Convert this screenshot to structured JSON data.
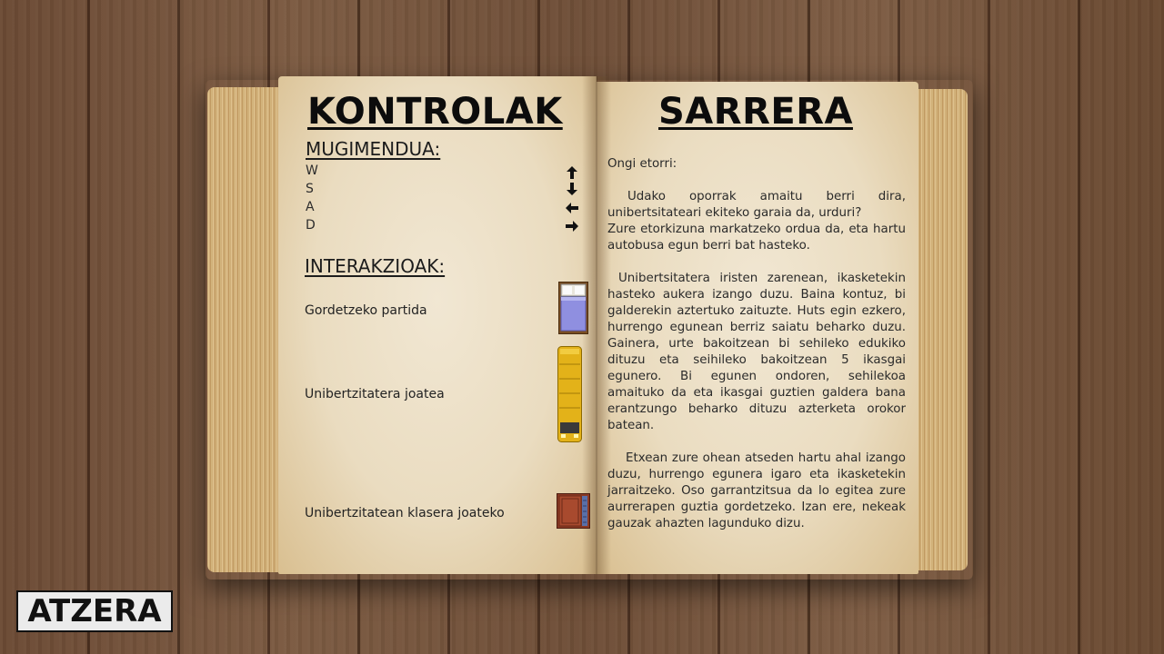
{
  "left_page": {
    "title": "KONTROLAK",
    "movement_heading": "MUGIMENDUA:",
    "keys": [
      {
        "key": "W",
        "icon": "arrow-up-icon"
      },
      {
        "key": "S",
        "icon": "arrow-down-icon"
      },
      {
        "key": "A",
        "icon": "arrow-left-icon"
      },
      {
        "key": "D",
        "icon": "arrow-right-icon"
      }
    ],
    "interactions_heading": "INTERAKZIOAK:",
    "actions": [
      {
        "label": "Gordetzeko partida",
        "icon": "bed-icon"
      },
      {
        "label": "Unibertzitatera joatea",
        "icon": "bus-icon"
      },
      {
        "label": "Unibertzitatean klasera joateko",
        "icon": "door-icon"
      }
    ]
  },
  "right_page": {
    "title": "SARRERA",
    "paragraphs": [
      "Ongi etorri:",
      "Udako oporrak amaitu berri dira, unibertsitateari ekiteko garaia da, urduri?",
      "Zure etorkizuna markatzeko ordua da, eta hartu autobusa egun berri bat hasteko.",
      "Unibertsitatera iristen zarenean, ikasketekin hasteko aukera izango duzu. Baina kontuz, bi galderekin aztertuko zaituzte. Huts egin ezkero, hurrengo egunean berriz saiatu beharko duzu. Gainera, urte bakoitzean bi sehileko edukiko dituzu eta seihileko bakoitzean 5 ikasgai egunero. Bi egunen ondoren, sehilekoa amaituko da eta ikasgai guztien galdera bana erantzungo beharko dituzu azterketa orokor batean.",
      "Etxean zure ohean atseden hartu ahal izango duzu, hurrengo egunera igaro eta ikasketekin jarraitzeko. Oso garrantzitsua da lo egitea zure aurrerapen guztia gordetzeko. Izan ere, nekeak gauzak ahazten lagunduko dizu."
    ]
  },
  "back_button": {
    "label": "ATZERA"
  },
  "colors": {
    "wood": "#6e4e37",
    "page": "#eadcc0",
    "ink": "#111111",
    "button_bg": "#ebebeb"
  }
}
